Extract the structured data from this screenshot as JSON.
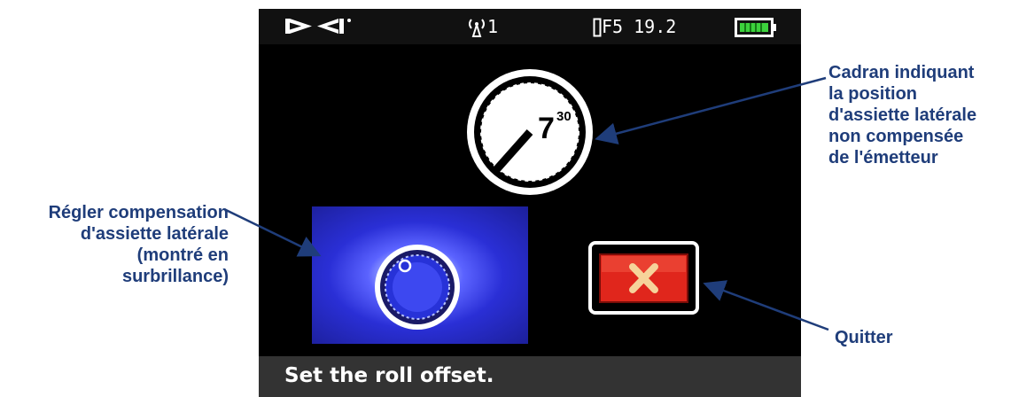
{
  "annotations": {
    "dial": [
      "Cadran indiquant",
      "la position",
      "d'assiette latérale",
      "non compensée",
      "de l'émetteur"
    ],
    "roll_offset": [
      "Régler compensation",
      "d'assiette latérale",
      "(montré en",
      "surbrillance)"
    ],
    "quit": "Quitter"
  },
  "status_bar": {
    "logo_icon": "dci-logo",
    "signal_value": "1",
    "frequency": "F5 19.2",
    "battery_icon": "battery-full-icon"
  },
  "roll": {
    "hour": "7",
    "minute": "30"
  },
  "menu": {
    "roll_offset_icon": "roll-offset-dial-icon",
    "roll_offset_state": "highlighted",
    "exit_icon": "close-x-icon"
  },
  "prompt": "Set the roll offset.",
  "colors": {
    "annotation_text": "#1f3d7a",
    "highlight_blue": "#2a2fd6",
    "exit_red": "#e0261c",
    "exit_x": "#f6d39a"
  }
}
